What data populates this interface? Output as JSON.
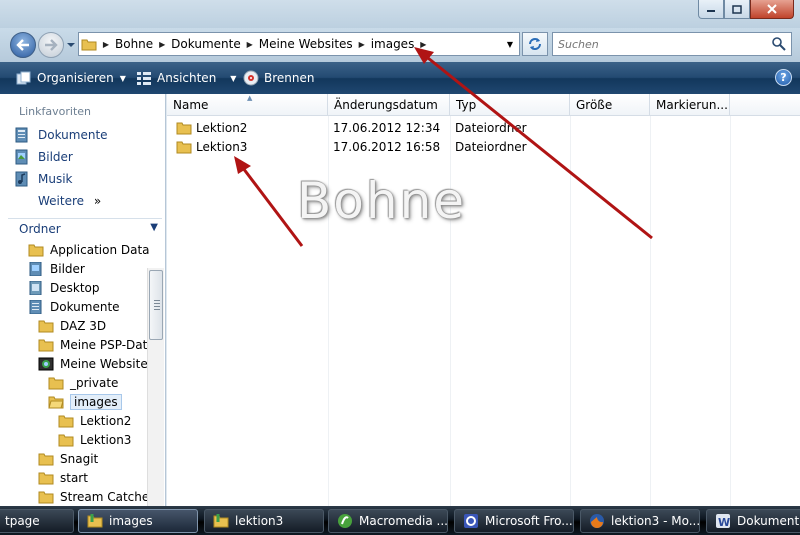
{
  "address": {
    "crumbs": [
      "Bohne",
      "Dokumente",
      "Meine Websites",
      "images"
    ]
  },
  "search": {
    "placeholder": "Suchen"
  },
  "toolbar": {
    "organize": "Organisieren",
    "views": "Ansichten",
    "burn": "Brennen",
    "help": "?"
  },
  "nav": {
    "favorites_title": "Linkfavoriten",
    "favorites": [
      {
        "label": "Dokumente",
        "icon": "documents-icon"
      },
      {
        "label": "Bilder",
        "icon": "pictures-icon"
      },
      {
        "label": "Musik",
        "icon": "music-icon"
      }
    ],
    "more": "Weitere",
    "more_glyph": "»",
    "folders_title": "Ordner",
    "tree": [
      "Application Data",
      "Bilder",
      "Desktop",
      "Dokumente",
      "DAZ 3D",
      "Meine PSP-Datei",
      "Meine Websites",
      "_private",
      "images",
      "Lektion2",
      "Lektion3",
      "Snagit",
      "start",
      "Stream Catcher"
    ]
  },
  "columns": [
    "Name",
    "Änderungsdatum",
    "Typ",
    "Größe",
    "Markierun..."
  ],
  "files": [
    {
      "name": "Lektion2",
      "modified": "17.06.2012 12:34",
      "type": "Dateiordner"
    },
    {
      "name": "Lektion3",
      "modified": "17.06.2012 16:58",
      "type": "Dateiordner"
    }
  ],
  "watermark": "Bohne",
  "taskbar": [
    "tpage",
    "images",
    "lektion3",
    "Macromedia ...",
    "Microsoft Fro...",
    "lektion3 - Mo...",
    "Dokument1 -"
  ],
  "colors": {
    "arrow": "#b01414",
    "toolbar": "#1f4770",
    "link": "#1a3e78",
    "folder": "#e8c050"
  }
}
